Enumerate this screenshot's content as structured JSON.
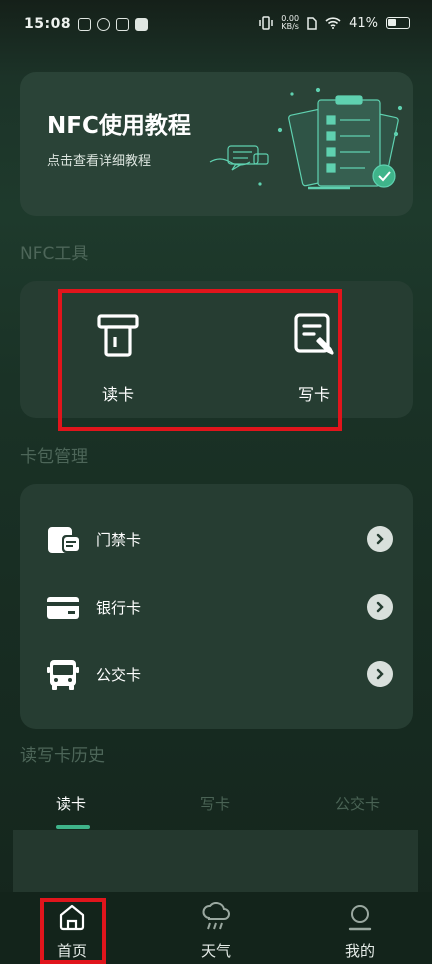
{
  "status_bar": {
    "time": "15:08",
    "net_speed_value": "0.00",
    "net_speed_unit": "KB/s",
    "battery": "41%"
  },
  "tutorial": {
    "title": "NFC使用教程",
    "subtitle": "点击查看详细教程"
  },
  "sections": {
    "tools_title": "NFC工具",
    "wallet_title": "卡包管理",
    "history_title": "读写卡历史"
  },
  "tools": [
    {
      "label": "读卡",
      "icon": "card-reader-icon"
    },
    {
      "label": "写卡",
      "icon": "write-card-icon"
    }
  ],
  "wallet": [
    {
      "label": "门禁卡",
      "icon": "access-card-icon"
    },
    {
      "label": "银行卡",
      "icon": "bank-card-icon"
    },
    {
      "label": "公交卡",
      "icon": "bus-icon"
    }
  ],
  "history_tabs": [
    {
      "label": "读卡",
      "active": true
    },
    {
      "label": "写卡",
      "active": false
    },
    {
      "label": "公交卡",
      "active": false
    }
  ],
  "bottom_nav": [
    {
      "label": "首页",
      "icon": "home-icon"
    },
    {
      "label": "天气",
      "icon": "weather-icon"
    },
    {
      "label": "我的",
      "icon": "profile-icon"
    }
  ],
  "colors": {
    "accent": "#3fb48a",
    "highlight": "#e0151c",
    "card": "#263d32"
  }
}
